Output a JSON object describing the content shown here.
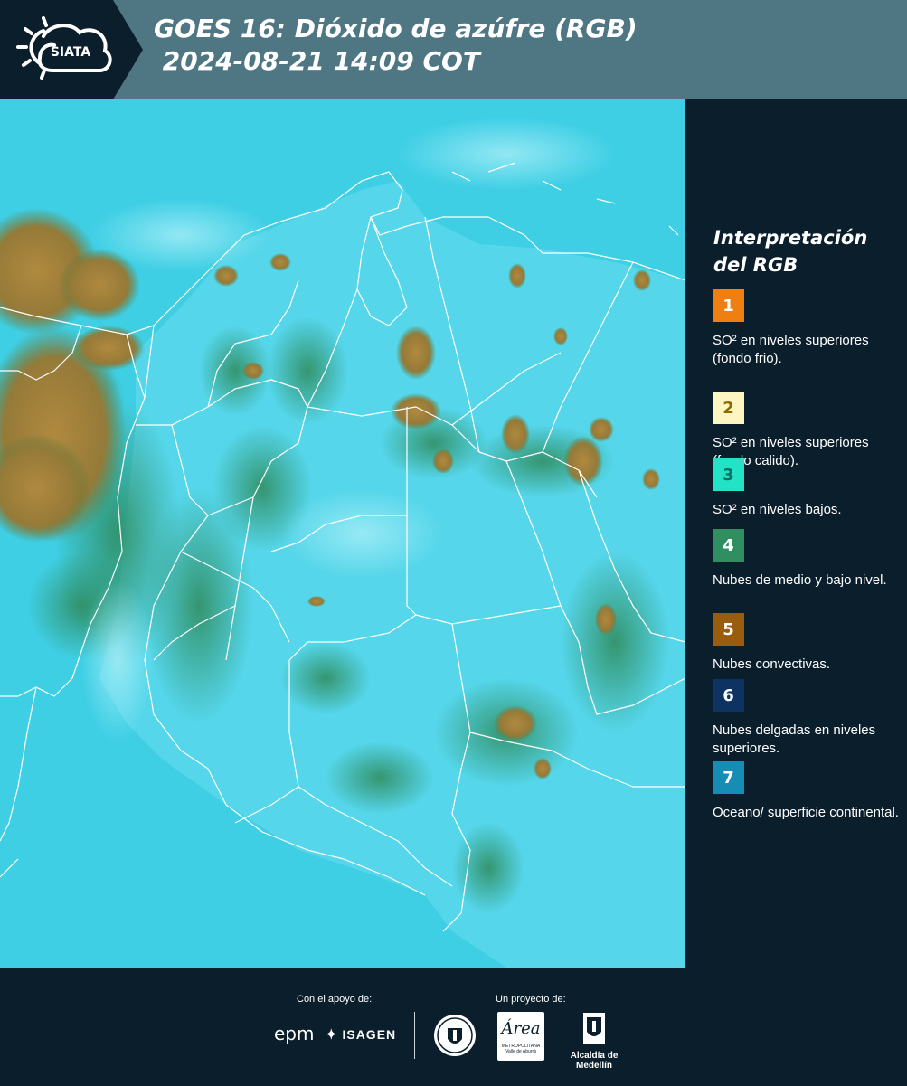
{
  "header": {
    "logo_text": "SIATA",
    "title_line1": "GOES 16: Dióxido de azúfre (RGB)",
    "title_line2": " 2024-08-21 14:09 COT"
  },
  "map": {
    "ocean_color": "#3fd0e6",
    "land_color": "#52cde4",
    "border_color": "#ffffff"
  },
  "legend": {
    "title_line1": "Interpretación",
    "title_line2": "del RGB",
    "items": [
      {
        "num": "1",
        "color": "#f07f12",
        "text_color": "#ffffff",
        "desc": "SO² en niveles superiores (fondo frio)."
      },
      {
        "num": "2",
        "color": "#fdf6c3",
        "text_color": "#8a6a00",
        "desc": "SO² en niveles superiores (fondo calido)."
      },
      {
        "num": "3",
        "color": "#22e3c6",
        "text_color": "#0b6f66",
        "desc": "SO² en niveles bajos."
      },
      {
        "num": "4",
        "color": "#2f8f61",
        "text_color": "#ffffff",
        "desc": "Nubes de medio y bajo nivel."
      },
      {
        "num": "5",
        "color": "#9a5d0d",
        "text_color": "#ffffff",
        "desc": "Nubes convectivas."
      },
      {
        "num": "6",
        "color": "#0c3361",
        "text_color": "#ffffff",
        "desc": "Nubes delgadas en niveles superiores."
      },
      {
        "num": "7",
        "color": "#178cb5",
        "text_color": "#ffffff",
        "desc": "Oceano/ superficie continental."
      }
    ]
  },
  "footer": {
    "support_label": "Con el apoyo de:",
    "project_label": "Un proyecto de:",
    "epm": "epm",
    "isagen": "ISAGEN",
    "area_word": "Área",
    "area_line1": "METROPOLITANA",
    "area_line2": "Valle de Aburrá",
    "alcaldia": "Alcaldía de Medellín"
  }
}
